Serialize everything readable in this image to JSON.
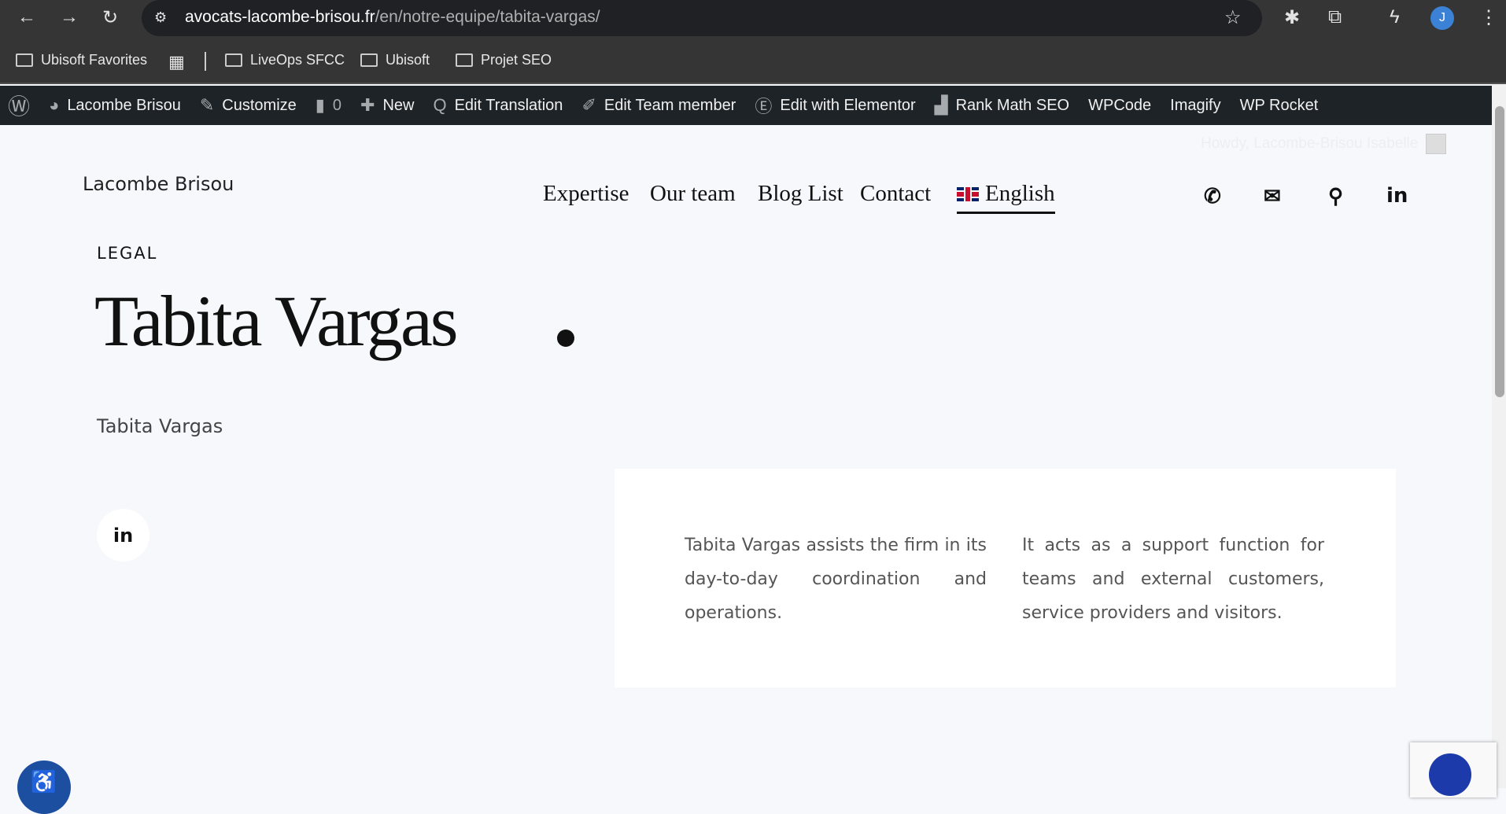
{
  "browser": {
    "url_host": "avocats-lacombe-brisou.fr",
    "url_path": "/en/notre-equipe/tabita-vargas/",
    "profile_initial": "J",
    "bookmarks": [
      "Ubisoft Favorites",
      "LiveOps SFCC",
      "Ubisoft",
      "Projet SEO"
    ]
  },
  "adminbar": {
    "site": "Lacombe Brisou",
    "customize": "Customize",
    "comments": "0",
    "new": "New",
    "edit_translation": "Edit Translation",
    "edit_team": "Edit Team member",
    "elementor": "Edit with Elementor",
    "rankmath": "Rank Math SEO",
    "wpcode": "WPCode",
    "imagify": "Imagify",
    "wprocket": "WP Rocket",
    "howdy": "Howdy, Lacombe-Brisou Isabelle"
  },
  "header": {
    "logo_alt": "Lacombe Brisou",
    "nav": [
      "Expertise",
      "Our team",
      "Blog List",
      "Contact"
    ],
    "language": "English"
  },
  "profile": {
    "category": "LEGAL",
    "name": "Tabita Vargas",
    "photo_alt": "Tabita Vargas",
    "linkedin": "in",
    "bio_left": "Tabita Vargas assists the firm in its day-to-day coordination and operations.",
    "bio_right": "It acts as a support function for teams and external customers, service providers and visitors."
  }
}
